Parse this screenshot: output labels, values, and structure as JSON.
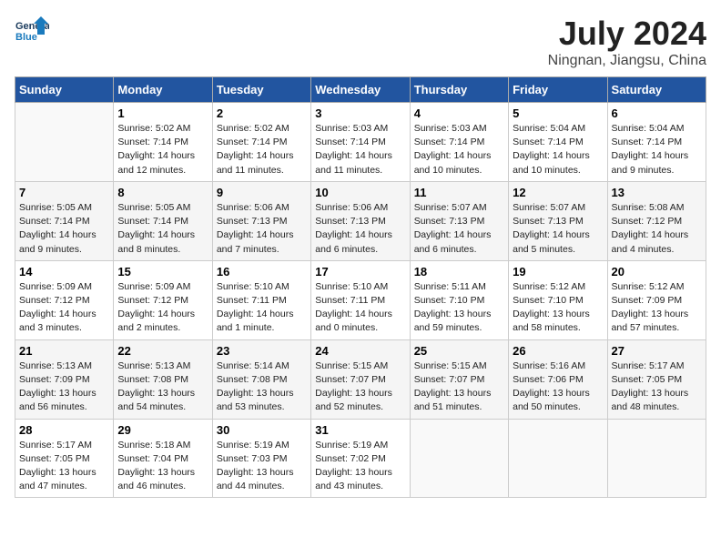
{
  "header": {
    "logo_line1": "General",
    "logo_line2": "Blue",
    "month_year": "July 2024",
    "location": "Ningnan, Jiangsu, China"
  },
  "weekdays": [
    "Sunday",
    "Monday",
    "Tuesday",
    "Wednesday",
    "Thursday",
    "Friday",
    "Saturday"
  ],
  "weeks": [
    [
      {
        "day": "",
        "info": ""
      },
      {
        "day": "1",
        "info": "Sunrise: 5:02 AM\nSunset: 7:14 PM\nDaylight: 14 hours\nand 12 minutes."
      },
      {
        "day": "2",
        "info": "Sunrise: 5:02 AM\nSunset: 7:14 PM\nDaylight: 14 hours\nand 11 minutes."
      },
      {
        "day": "3",
        "info": "Sunrise: 5:03 AM\nSunset: 7:14 PM\nDaylight: 14 hours\nand 11 minutes."
      },
      {
        "day": "4",
        "info": "Sunrise: 5:03 AM\nSunset: 7:14 PM\nDaylight: 14 hours\nand 10 minutes."
      },
      {
        "day": "5",
        "info": "Sunrise: 5:04 AM\nSunset: 7:14 PM\nDaylight: 14 hours\nand 10 minutes."
      },
      {
        "day": "6",
        "info": "Sunrise: 5:04 AM\nSunset: 7:14 PM\nDaylight: 14 hours\nand 9 minutes."
      }
    ],
    [
      {
        "day": "7",
        "info": "Sunrise: 5:05 AM\nSunset: 7:14 PM\nDaylight: 14 hours\nand 9 minutes."
      },
      {
        "day": "8",
        "info": "Sunrise: 5:05 AM\nSunset: 7:14 PM\nDaylight: 14 hours\nand 8 minutes."
      },
      {
        "day": "9",
        "info": "Sunrise: 5:06 AM\nSunset: 7:13 PM\nDaylight: 14 hours\nand 7 minutes."
      },
      {
        "day": "10",
        "info": "Sunrise: 5:06 AM\nSunset: 7:13 PM\nDaylight: 14 hours\nand 6 minutes."
      },
      {
        "day": "11",
        "info": "Sunrise: 5:07 AM\nSunset: 7:13 PM\nDaylight: 14 hours\nand 6 minutes."
      },
      {
        "day": "12",
        "info": "Sunrise: 5:07 AM\nSunset: 7:13 PM\nDaylight: 14 hours\nand 5 minutes."
      },
      {
        "day": "13",
        "info": "Sunrise: 5:08 AM\nSunset: 7:12 PM\nDaylight: 14 hours\nand 4 minutes."
      }
    ],
    [
      {
        "day": "14",
        "info": "Sunrise: 5:09 AM\nSunset: 7:12 PM\nDaylight: 14 hours\nand 3 minutes."
      },
      {
        "day": "15",
        "info": "Sunrise: 5:09 AM\nSunset: 7:12 PM\nDaylight: 14 hours\nand 2 minutes."
      },
      {
        "day": "16",
        "info": "Sunrise: 5:10 AM\nSunset: 7:11 PM\nDaylight: 14 hours\nand 1 minute."
      },
      {
        "day": "17",
        "info": "Sunrise: 5:10 AM\nSunset: 7:11 PM\nDaylight: 14 hours\nand 0 minutes."
      },
      {
        "day": "18",
        "info": "Sunrise: 5:11 AM\nSunset: 7:10 PM\nDaylight: 13 hours\nand 59 minutes."
      },
      {
        "day": "19",
        "info": "Sunrise: 5:12 AM\nSunset: 7:10 PM\nDaylight: 13 hours\nand 58 minutes."
      },
      {
        "day": "20",
        "info": "Sunrise: 5:12 AM\nSunset: 7:09 PM\nDaylight: 13 hours\nand 57 minutes."
      }
    ],
    [
      {
        "day": "21",
        "info": "Sunrise: 5:13 AM\nSunset: 7:09 PM\nDaylight: 13 hours\nand 56 minutes."
      },
      {
        "day": "22",
        "info": "Sunrise: 5:13 AM\nSunset: 7:08 PM\nDaylight: 13 hours\nand 54 minutes."
      },
      {
        "day": "23",
        "info": "Sunrise: 5:14 AM\nSunset: 7:08 PM\nDaylight: 13 hours\nand 53 minutes."
      },
      {
        "day": "24",
        "info": "Sunrise: 5:15 AM\nSunset: 7:07 PM\nDaylight: 13 hours\nand 52 minutes."
      },
      {
        "day": "25",
        "info": "Sunrise: 5:15 AM\nSunset: 7:07 PM\nDaylight: 13 hours\nand 51 minutes."
      },
      {
        "day": "26",
        "info": "Sunrise: 5:16 AM\nSunset: 7:06 PM\nDaylight: 13 hours\nand 50 minutes."
      },
      {
        "day": "27",
        "info": "Sunrise: 5:17 AM\nSunset: 7:05 PM\nDaylight: 13 hours\nand 48 minutes."
      }
    ],
    [
      {
        "day": "28",
        "info": "Sunrise: 5:17 AM\nSunset: 7:05 PM\nDaylight: 13 hours\nand 47 minutes."
      },
      {
        "day": "29",
        "info": "Sunrise: 5:18 AM\nSunset: 7:04 PM\nDaylight: 13 hours\nand 46 minutes."
      },
      {
        "day": "30",
        "info": "Sunrise: 5:19 AM\nSunset: 7:03 PM\nDaylight: 13 hours\nand 44 minutes."
      },
      {
        "day": "31",
        "info": "Sunrise: 5:19 AM\nSunset: 7:02 PM\nDaylight: 13 hours\nand 43 minutes."
      },
      {
        "day": "",
        "info": ""
      },
      {
        "day": "",
        "info": ""
      },
      {
        "day": "",
        "info": ""
      }
    ]
  ]
}
